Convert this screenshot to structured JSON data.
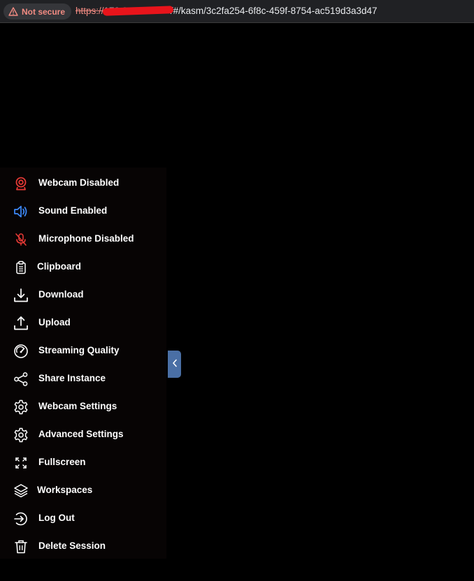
{
  "browser": {
    "security_label": "Not secure",
    "url_scheme": "https://",
    "url_host_visible": "172.25",
    "url_path": "/#/kasm/3c2fa254-6f8c-459f-8754-ac519d3a3d47",
    "warning_color": "#f28b82"
  },
  "menu": {
    "items": [
      {
        "label": "Webcam Disabled",
        "icon": "webcam-icon",
        "color": "#e53935"
      },
      {
        "label": "Sound Enabled",
        "icon": "speaker-icon",
        "color": "#3d8bfd"
      },
      {
        "label": "Microphone Disabled",
        "icon": "microphone-off-icon",
        "color": "#e53935"
      },
      {
        "label": "Clipboard",
        "icon": "clipboard-icon",
        "color": "#ffffff"
      },
      {
        "label": "Download",
        "icon": "download-icon",
        "color": "#ffffff"
      },
      {
        "label": "Upload",
        "icon": "upload-icon",
        "color": "#ffffff"
      },
      {
        "label": "Streaming Quality",
        "icon": "gauge-icon",
        "color": "#ffffff"
      },
      {
        "label": "Share Instance",
        "icon": "share-icon",
        "color": "#ffffff"
      },
      {
        "label": "Webcam Settings",
        "icon": "gear-icon",
        "color": "#ffffff"
      },
      {
        "label": "Advanced Settings",
        "icon": "gear-icon",
        "color": "#ffffff"
      },
      {
        "label": "Fullscreen",
        "icon": "fullscreen-icon",
        "color": "#ffffff"
      },
      {
        "label": "Workspaces",
        "icon": "layers-icon",
        "color": "#ffffff"
      },
      {
        "label": "Log Out",
        "icon": "logout-icon",
        "color": "#ffffff"
      },
      {
        "label": "Delete Session",
        "icon": "trash-icon",
        "color": "#ffffff"
      }
    ]
  },
  "panel_toggle": {
    "icon": "chevron-left-icon",
    "color": "#4a6fa5"
  }
}
